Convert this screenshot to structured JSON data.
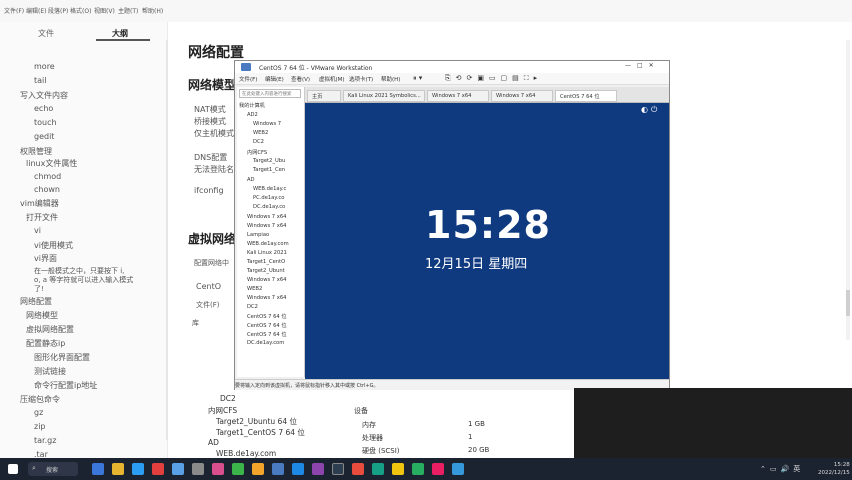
{
  "app_menu": [
    "文件(F)",
    "编辑(E)",
    "段落(P)",
    "格式(O)",
    "视图(V)",
    "主题(T)",
    "帮助(H)"
  ],
  "sidebar": {
    "tabs": [
      "文件",
      "大纲"
    ],
    "items": [
      "more",
      "tail",
      "写入文件内容",
      "echo",
      "touch",
      "gedit",
      "权限管理",
      "linux文件属性",
      "chmod",
      "chown",
      "vim编辑器",
      "打开文件",
      "vi",
      "vi使用模式",
      "vi界面",
      "在一般模式之中，只要按下 i,",
      "o, a 等字符就可以进入输入模式",
      "了!",
      "网络配置",
      "网络模型",
      "虚拟网络配置",
      "配置静态ip",
      "图形化界面配置",
      "测试链接",
      "命令行配置ip地址",
      "压缩包命令",
      "gz",
      "zip",
      "tar.gz",
      ".tar"
    ]
  },
  "doc": {
    "h1": "网络配置",
    "h2": "网络模型",
    "model_lines": [
      "NAT模式",
      "桥接模式",
      "仅主机模式"
    ],
    "dns_lines": [
      "DNS配置",
      "无法登陆名称"
    ],
    "ifconfig": "ifconfig",
    "h3": "虚拟网络配置",
    "vnet_line": "配置网络中",
    "centos_short": "CentO",
    "file_menu": "文件(F)",
    "lib_label": "库"
  },
  "vmware": {
    "title": "CentOS 7 64 位 - VMware Workstation",
    "menu": [
      "文件(F)",
      "编辑(E)",
      "查看(V)",
      "虚拟机(M)",
      "选项卡(T)",
      "帮助(H)"
    ],
    "library_search": "在此处键入内容进行搜索",
    "library": [
      "我的计算机",
      "AD2",
      "Windows 7",
      "WEB2",
      "DC2",
      "内网CFS",
      "Target2_Ubu",
      "Target1_Cen",
      "AD",
      "WEB.de1ay.c",
      "PC.de1ay.co",
      "DC.de1ay.co",
      "Windows 7 x64",
      "Windows 7 x64",
      "Lampiao",
      "WEB.de1ay.com",
      "Kali Linux 2021",
      "Target1_CentO",
      "Target2_Ubunt",
      "Windows 7 x64",
      "WEB2",
      "Windows 7 x64",
      "DC2",
      "CentOS 7 64 位",
      "CentOS 7 64 位",
      "CentOS 7 64 位",
      "DC.de1ay.com"
    ],
    "tabs": [
      "主页",
      "Kali Linux 2021 Symbolics...",
      "Windows 7 x64",
      "Windows 7 x64",
      "CentOS 7 64 位"
    ],
    "screen_time": "15:28",
    "screen_date": "12月15日 星期四",
    "status": "要将输入定向到该虚拟机，请将鼠标指针移入其中或按 Ctrl+G。"
  },
  "lower": {
    "tree": [
      "DC2",
      "内网CFS",
      "Target2_Ubuntu 64 位",
      "Target1_CentOS 7 64 位",
      "AD",
      "WEB.de1ay.com"
    ],
    "devices_header": "设备",
    "devices": [
      {
        "name": "内存",
        "value": "1 GB"
      },
      {
        "name": "处理器",
        "value": "1"
      },
      {
        "name": "硬盘 (SCSI)",
        "value": "20 GB"
      }
    ]
  },
  "taskbar": {
    "search_label": "搜索",
    "time": "15:28",
    "date": "2022/12/15"
  },
  "colors": {
    "vm_screen_bg": "#0f3a80",
    "taskbar_bg": "#1c2330"
  }
}
